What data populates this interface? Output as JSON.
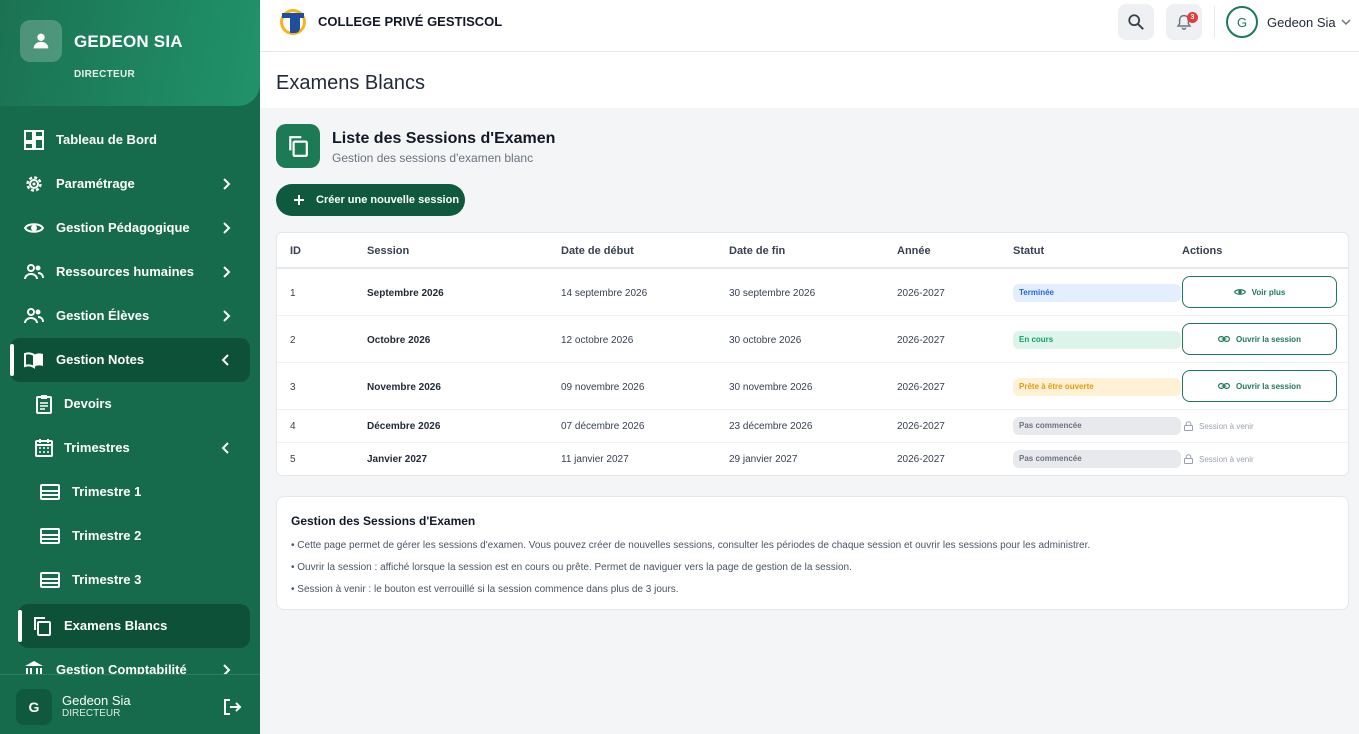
{
  "sidebar": {
    "user_name": "GEDEON SIA",
    "user_role": "DIRECTEUR",
    "items": [
      {
        "label": "Tableau de Bord",
        "icon": "dashboard-icon"
      },
      {
        "label": "Paramétrage",
        "icon": "gear-icon"
      },
      {
        "label": "Gestion Pédagogique",
        "icon": "eye-icon"
      },
      {
        "label": "Ressources humaines",
        "icon": "people-icon"
      },
      {
        "label": "Gestion Élèves",
        "icon": "people-icon"
      },
      {
        "label": "Gestion Notes",
        "icon": "book-icon"
      },
      {
        "label": "Devoirs",
        "icon": "clipboard-icon"
      },
      {
        "label": "Trimestres",
        "icon": "calendar-icon"
      },
      {
        "label": "Trimestre 1",
        "icon": "layers-icon"
      },
      {
        "label": "Trimestre 2",
        "icon": "layers-icon"
      },
      {
        "label": "Trimestre 3",
        "icon": "layers-icon"
      },
      {
        "label": "Examens Blancs",
        "icon": "copy-icon"
      },
      {
        "label": "Gestion Comptabilité",
        "icon": "bank-icon"
      }
    ],
    "footer": {
      "avatar": "G",
      "name": "Gedeon Sia",
      "role": "DIRECTEUR"
    }
  },
  "header": {
    "school_name": "COLLEGE PRIVÉ GESTISCOL",
    "notification_count": "3",
    "user_initial": "G",
    "user_name": "Gedeon Sia"
  },
  "page": {
    "title": "Examens Blancs",
    "section_title": "Liste des Sessions d'Examen",
    "section_subtitle": "Gestion des sessions d'examen blanc",
    "create_button": "Créer une nouvelle session"
  },
  "table": {
    "headers": [
      "ID",
      "Session",
      "Date de début",
      "Date de fin",
      "Année",
      "Statut",
      "Actions"
    ],
    "rows": [
      {
        "id": "1",
        "session": "Septembre 2026",
        "start": "14 septembre 2026",
        "end": "30 septembre 2026",
        "year": "2026-2027",
        "status": "Terminée",
        "action": "Voir plus"
      },
      {
        "id": "2",
        "session": "Octobre 2026",
        "start": "12 octobre 2026",
        "end": "30 octobre 2026",
        "year": "2026-2027",
        "status": "En cours",
        "action": "Ouvrir la session"
      },
      {
        "id": "3",
        "session": "Novembre 2026",
        "start": "09 novembre 2026",
        "end": "30 novembre 2026",
        "year": "2026-2027",
        "status": "Prête à être ouverte",
        "action": "Ouvrir la session"
      },
      {
        "id": "4",
        "session": "Décembre 2026",
        "start": "07 décembre 2026",
        "end": "23 décembre 2026",
        "year": "2026-2027",
        "status": "Pas commencée",
        "action": "Session à venir"
      },
      {
        "id": "5",
        "session": "Janvier 2027",
        "start": "11 janvier 2027",
        "end": "29 janvier 2027",
        "year": "2026-2027",
        "status": "Pas commencée",
        "action": "Session à venir"
      }
    ]
  },
  "info": {
    "title": "Gestion des Sessions d'Examen",
    "lines": [
      "• Cette page permet de gérer les sessions d'examen. Vous pouvez créer de nouvelles sessions, consulter les périodes de chaque session et ouvrir les sessions pour les administrer.",
      "• Ouvrir la session : affiché lorsque la session est en cours ou prête. Permet de naviguer vers la page de gestion de la session.",
      "• Session à venir : le bouton est verrouillé si la session commence dans plus de 3 jours."
    ]
  },
  "colors": {
    "sidebar": "#176b4d",
    "primary": "#1c7a55",
    "primary_dark": "#0f5a3f",
    "status_done": "#2563eb",
    "status_in_progress": "#10a36a",
    "status_ready": "#e59a0a",
    "status_not_started": "#6b7280"
  }
}
